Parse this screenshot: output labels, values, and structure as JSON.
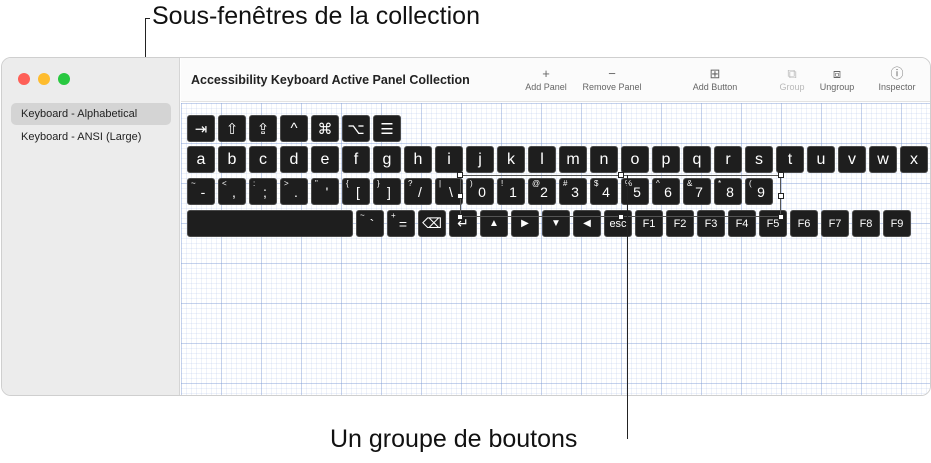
{
  "callouts": {
    "top": "Sous-fenêtres de la collection",
    "bottom": "Un groupe de boutons"
  },
  "window": {
    "title": "Accessibility Keyboard Active Panel Collection",
    "traffic_lights": [
      "#fe5f57",
      "#febc2e",
      "#28c840"
    ]
  },
  "sidebar": {
    "items": [
      {
        "label": "Keyboard - Alphabetical",
        "selected": true
      },
      {
        "label": "Keyboard - ANSI (Large)",
        "selected": false
      }
    ]
  },
  "toolbar": {
    "buttons": [
      {
        "label": "Add Panel",
        "icon": "plus-icon",
        "glyph": "+"
      },
      {
        "label": "Remove Panel",
        "icon": "minus-icon",
        "glyph": "−"
      },
      {
        "label": "Add Button",
        "icon": "add-button-icon",
        "glyph": "⊞"
      },
      {
        "label": "Group",
        "icon": "group-icon",
        "glyph": "⧉",
        "disabled": true
      },
      {
        "label": "Ungroup",
        "icon": "ungroup-icon",
        "glyph": "⧈"
      },
      {
        "label": "Inspector",
        "icon": "info-icon",
        "glyph": "ⓘ"
      }
    ]
  },
  "keyboard": {
    "row_modifiers": [
      "⇥",
      "⇧",
      "⇪",
      "^",
      "⌘",
      "⌥",
      "☰"
    ],
    "row_letters": [
      "a",
      "b",
      "c",
      "d",
      "e",
      "f",
      "g",
      "h",
      "i",
      "j",
      "k",
      "l",
      "m",
      "n",
      "o",
      "p",
      "q",
      "r",
      "s",
      "t",
      "u",
      "v",
      "w",
      "x"
    ],
    "row_num": [
      {
        "shift": "~",
        "main": "-"
      },
      {
        "shift": "<",
        "main": ","
      },
      {
        "shift": ":",
        "main": ";"
      },
      {
        "shift": ">",
        "main": "."
      },
      {
        "shift": "\"",
        "main": "'"
      },
      {
        "shift": "{",
        "main": "["
      },
      {
        "shift": "}",
        "main": "]"
      },
      {
        "shift": "?",
        "main": "/"
      },
      {
        "shift": "|",
        "main": "\\"
      },
      {
        "shift": ")",
        "main": "0"
      },
      {
        "shift": "!",
        "main": "1"
      },
      {
        "shift": "@",
        "main": "2"
      },
      {
        "shift": "#",
        "main": "3"
      },
      {
        "shift": "$",
        "main": "4"
      },
      {
        "shift": "%",
        "main": "5"
      },
      {
        "shift": "^",
        "main": "6"
      },
      {
        "shift": "&",
        "main": "7"
      },
      {
        "shift": "*",
        "main": "8"
      },
      {
        "shift": "(",
        "main": "9"
      }
    ],
    "row_bottom": [
      {
        "shift": "",
        "main": "",
        "wide": true
      },
      {
        "shift": "~",
        "main": "`"
      },
      {
        "shift": "+",
        "main": "="
      },
      {
        "shift": "",
        "main": "⌫"
      },
      {
        "shift": "",
        "main": "↵"
      },
      {
        "shift": "",
        "main": "▲",
        "small": true
      },
      {
        "shift": "",
        "main": "▶",
        "small": true
      },
      {
        "shift": "",
        "main": "▼",
        "small": true
      },
      {
        "shift": "",
        "main": "◀",
        "small": true
      },
      {
        "shift": "",
        "main": "esc",
        "fn": true
      },
      {
        "shift": "",
        "main": "F1",
        "fn": true
      },
      {
        "shift": "",
        "main": "F2",
        "fn": true
      },
      {
        "shift": "",
        "main": "F3",
        "fn": true
      },
      {
        "shift": "",
        "main": "F4",
        "fn": true
      },
      {
        "shift": "",
        "main": "F5",
        "fn": true
      },
      {
        "shift": "",
        "main": "F6",
        "fn": true
      },
      {
        "shift": "",
        "main": "F7",
        "fn": true
      },
      {
        "shift": "",
        "main": "F8",
        "fn": true
      },
      {
        "shift": "",
        "main": "F9",
        "fn": true
      }
    ]
  }
}
